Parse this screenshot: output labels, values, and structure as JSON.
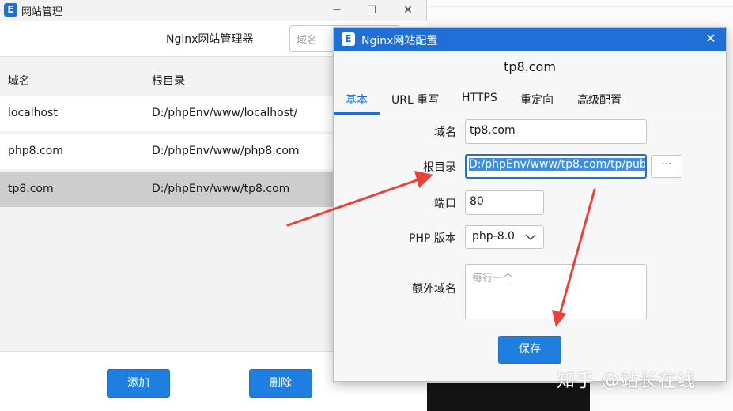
{
  "background": {
    "watermark": "知乎 @站长在线"
  },
  "left_window": {
    "title": "网站管理",
    "controls": {
      "minimize": "─",
      "maximize": "☐",
      "close": "✕"
    },
    "header_title": "Nginx网站管理器",
    "search_placeholder": "域名",
    "columns": [
      "域名",
      "根目录"
    ],
    "rows": [
      {
        "domain": "localhost",
        "root": "D:/phpEnv/www/localhost/"
      },
      {
        "domain": "php8.com",
        "root": "D:/phpEnv/www/php8.com"
      },
      {
        "domain": "tp8.com",
        "root": "D:/phpEnv/www/tp8.com"
      }
    ],
    "selected_row": 2,
    "add_button": "添加",
    "delete_button": "删除"
  },
  "dialog": {
    "title": "Nginx网站配置",
    "close": "✕",
    "heading": "tp8.com",
    "tabs": [
      "基本",
      "URL 重写",
      "HTTPS",
      "重定向",
      "高级配置"
    ],
    "active_tab": 0,
    "form": {
      "domain_label": "域名",
      "domain_value": "tp8.com",
      "root_label": "根目录",
      "root_value": "D:/phpEnv/www/tp8.com/tp/pub",
      "browse_label": "···",
      "port_label": "端口",
      "port_value": "80",
      "php_label": "PHP 版本",
      "php_value": "php-8.0",
      "extra_label": "额外域名",
      "extra_placeholder": "每行一个"
    },
    "save_button": "保存"
  },
  "colors": {
    "accent": "#1f6fd6",
    "button": "#1f7fe0",
    "arrow": "#e8423a",
    "selected_row": "#cdcdcd"
  },
  "icons": [
    "app-e-icon",
    "minimize-icon",
    "maximize-icon",
    "close-icon",
    "chevron-down-icon",
    "arrow-annotation"
  ]
}
